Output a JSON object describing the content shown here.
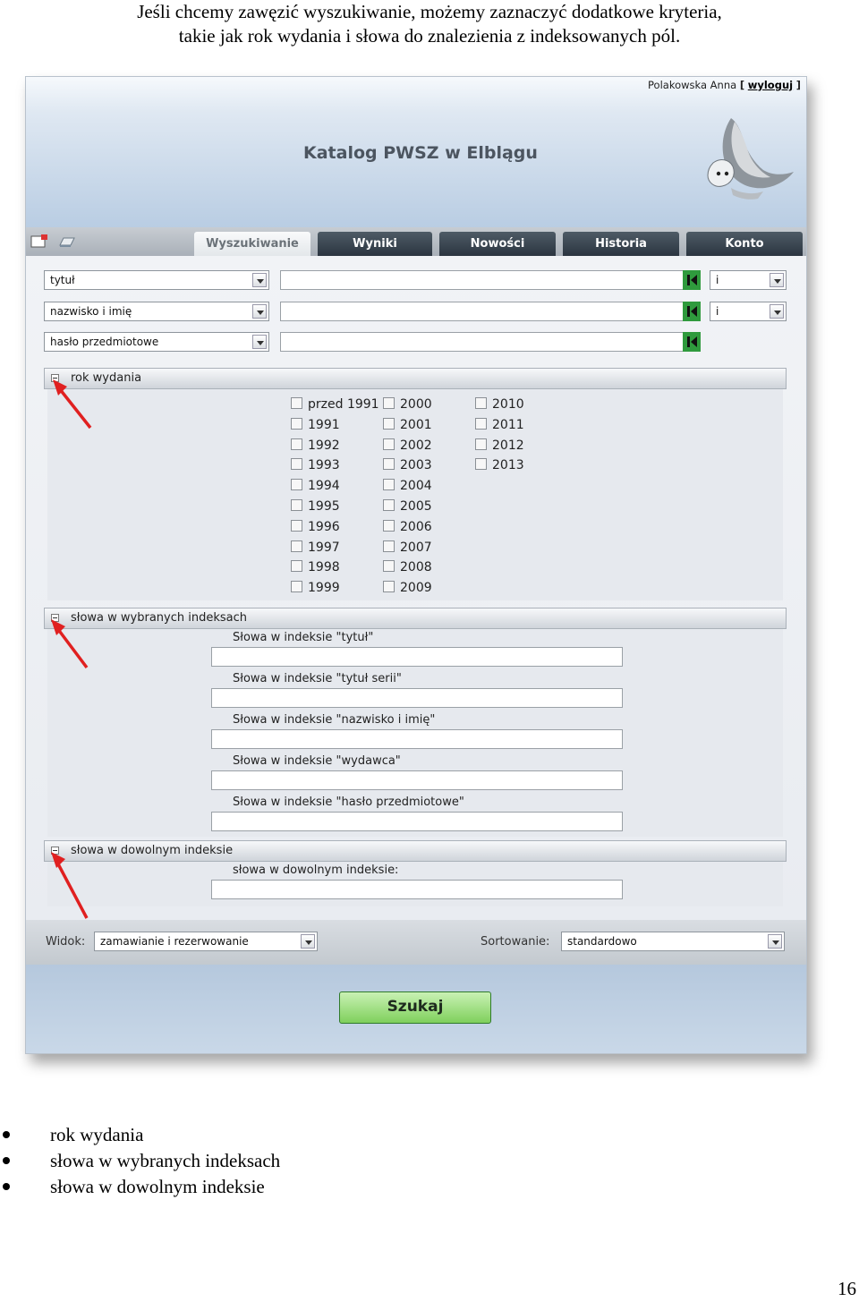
{
  "intro": {
    "line1": "Jeśli chcemy zawęzić wyszukiwanie, możemy zaznaczyć dodatkowe kryteria,",
    "line2": "takie jak rok wydania i słowa do znalezienia z indeksowanych pól."
  },
  "header": {
    "user": "Polakowska Anna",
    "bracket_open": "[",
    "logout": "wyloguj",
    "bracket_close": "]",
    "title": "Katalog PWSZ w Elblągu",
    "logo_icon": "owl-icon"
  },
  "tabs": [
    "Wyszukiwanie",
    "Wyniki",
    "Nowości",
    "Historia",
    "Konto"
  ],
  "search_rows": [
    {
      "field": "tytuł",
      "value": "",
      "operator": "i"
    },
    {
      "field": "nazwisko i imię",
      "value": "",
      "operator": "i"
    },
    {
      "field": "hasło przedmiotowe",
      "value": ""
    }
  ],
  "year_section": {
    "title": "rok wydania",
    "col1": [
      "przed 1991",
      "1991",
      "1992",
      "1993",
      "1994",
      "1995",
      "1996",
      "1997",
      "1998",
      "1999"
    ],
    "col2": [
      "2000",
      "2001",
      "2002",
      "2003",
      "2004",
      "2005",
      "2006",
      "2007",
      "2008",
      "2009"
    ],
    "col3": [
      "2010",
      "2011",
      "2012",
      "2013"
    ]
  },
  "index_section": {
    "title": "słowa w wybranych indeksach",
    "fields": [
      "Słowa w indeksie \"tytuł\"",
      "Słowa w indeksie \"tytuł serii\"",
      "Słowa w indeksie \"nazwisko i imię\"",
      "Słowa w indeksie \"wydawca\"",
      "Słowa w indeksie \"hasło przedmiotowe\""
    ]
  },
  "any_section": {
    "title": "słowa w dowolnym indeksie",
    "field": "słowa w dowolnym indeksie:"
  },
  "bottom": {
    "view_label": "Widok:",
    "view_value": "zamawianie i rezerwowanie",
    "sort_label": "Sortowanie:",
    "sort_value": "standardowo"
  },
  "search_button": "Szukaj",
  "bullets": [
    "rok wydania",
    "słowa w wybranych indeksach",
    "słowa w dowolnym indeksie"
  ],
  "page_number": "16",
  "colors": {
    "active_tab": "#f2f4f6",
    "tab": "#3a4550",
    "search_button": "#8ed66a",
    "arrow": "#e02020"
  }
}
